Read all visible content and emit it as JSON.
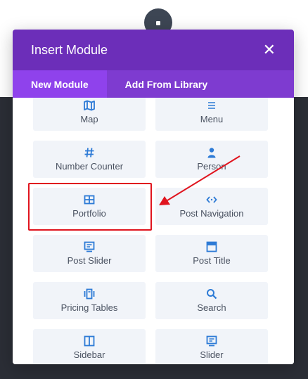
{
  "modal": {
    "title": "Insert Module",
    "close_glyph": "✕"
  },
  "tabs": [
    {
      "label": "New Module",
      "active": true
    },
    {
      "label": "Add From Library",
      "active": false
    }
  ],
  "modules": [
    {
      "label": "Map",
      "icon": "map-icon"
    },
    {
      "label": "Menu",
      "icon": "menu-icon"
    },
    {
      "label": "Number Counter",
      "icon": "hash-icon"
    },
    {
      "label": "Person",
      "icon": "person-icon"
    },
    {
      "label": "Portfolio",
      "icon": "grid-icon"
    },
    {
      "label": "Post Navigation",
      "icon": "code-nav-icon"
    },
    {
      "label": "Post Slider",
      "icon": "slider-icon"
    },
    {
      "label": "Post Title",
      "icon": "title-icon"
    },
    {
      "label": "Pricing Tables",
      "icon": "pricing-icon"
    },
    {
      "label": "Search",
      "icon": "search-icon"
    },
    {
      "label": "Sidebar",
      "icon": "sidebar-icon"
    },
    {
      "label": "Slider",
      "icon": "slider-icon"
    }
  ],
  "colors": {
    "header": "#6c2eb9",
    "tabs_bar": "#7e3bd0",
    "tab_active": "#8f42ec",
    "icon": "#2e7bd6",
    "annotation": "#e0141e"
  }
}
